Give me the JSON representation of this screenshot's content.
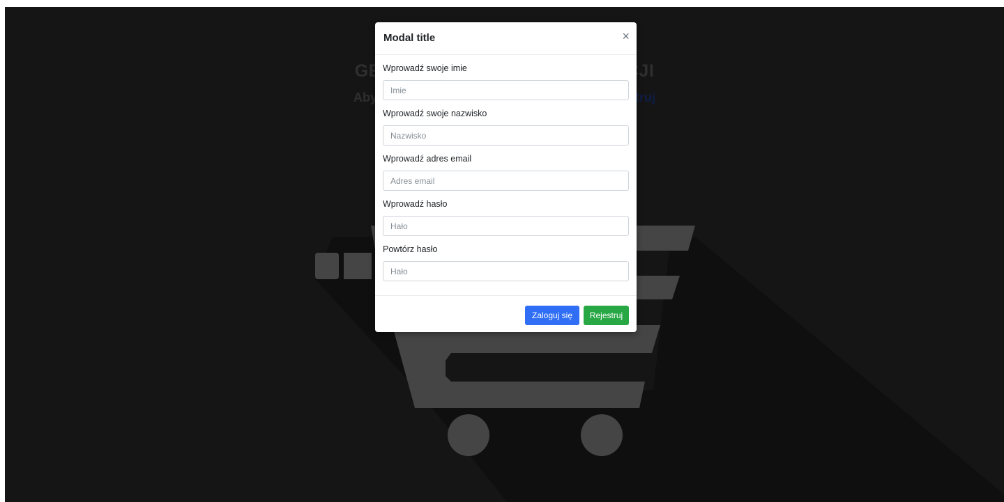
{
  "page": {
    "heading_left": "GEN",
    "heading_right": "KCJI",
    "subheading_left": "Aby",
    "subheading_link": "truj"
  },
  "modal": {
    "title": "Modal title",
    "close_label": "×",
    "fields": [
      {
        "label": "Wprowadź swoje imie",
        "placeholder": "Imie",
        "value": ""
      },
      {
        "label": "Wprowadź swoje nazwisko",
        "placeholder": "Nazwisko",
        "value": ""
      },
      {
        "label": "Wprowadź adres email",
        "placeholder": "Adres email",
        "value": ""
      },
      {
        "label": "Wprowadź hasło",
        "placeholder": "Hało",
        "value": ""
      },
      {
        "label": "Powtórz hasło",
        "placeholder": "Hało",
        "value": ""
      }
    ],
    "footer": {
      "login_label": "Zaloguj się",
      "register_label": "Rejestruj"
    }
  },
  "colors": {
    "login_button": "#2f6ef5",
    "register_button": "#28a745",
    "background": "#2a2a2a",
    "cart": "#8a8a8a"
  },
  "icons": {
    "background": "shopping-cart-icon"
  }
}
